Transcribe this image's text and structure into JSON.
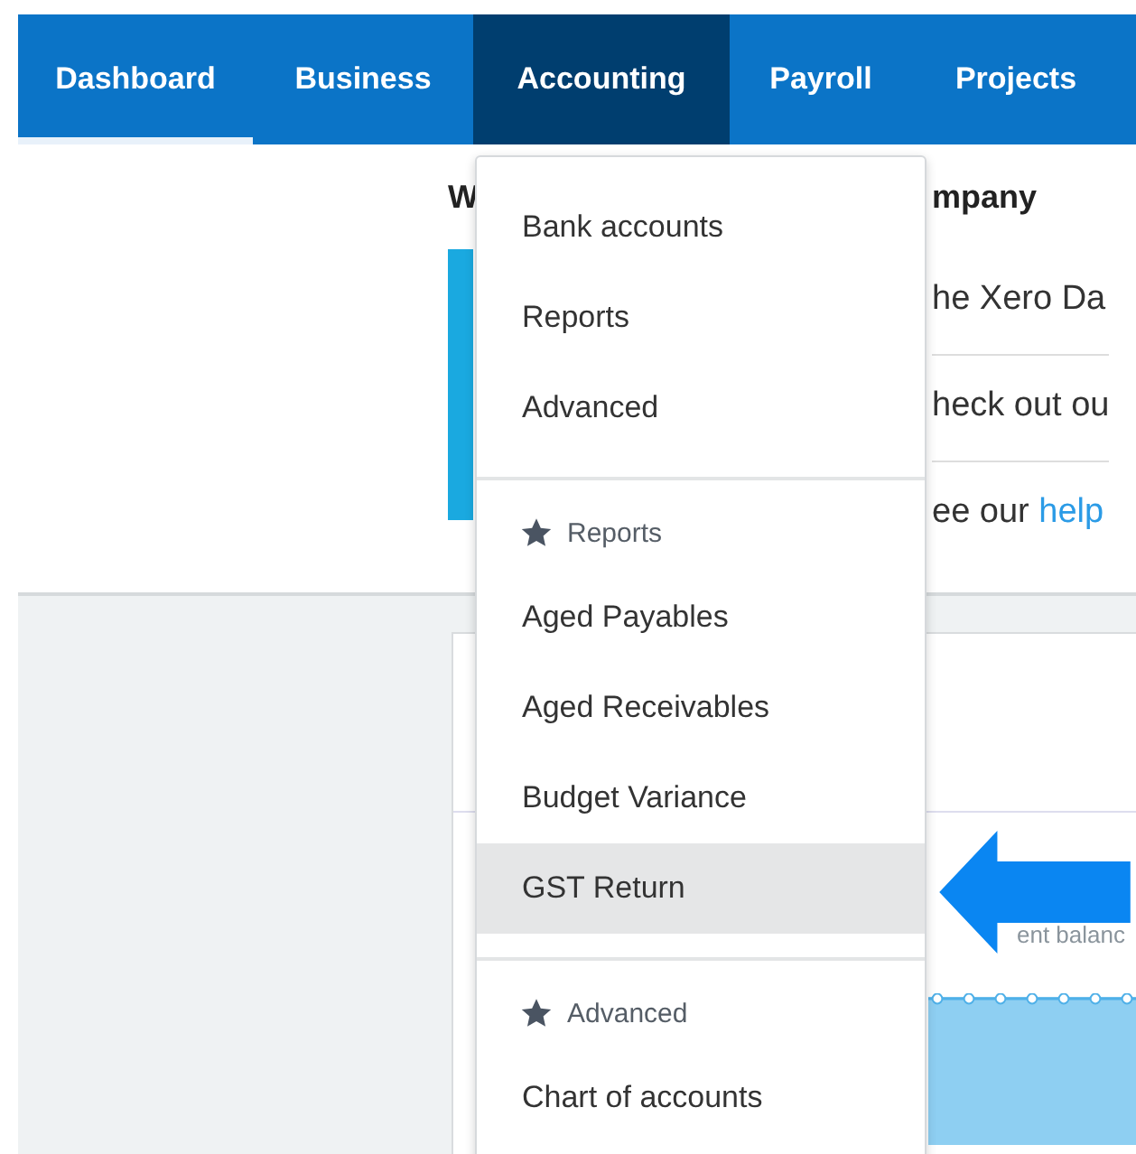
{
  "nav": {
    "tabs": [
      {
        "label": "Dashboard",
        "selected": false,
        "underlined": true
      },
      {
        "label": "Business",
        "selected": false,
        "underlined": false
      },
      {
        "label": "Accounting",
        "selected": true,
        "underlined": false
      },
      {
        "label": "Payroll",
        "selected": false,
        "underlined": false
      },
      {
        "label": "Projects",
        "selected": false,
        "underlined": false
      }
    ]
  },
  "page": {
    "heading_start": "W",
    "heading_end": "mpany",
    "rows": [
      {
        "text": "he Xero Da"
      },
      {
        "text": "heck out ou"
      },
      {
        "text": "ee our ",
        "link": "help"
      }
    ]
  },
  "card": {
    "caption": "ent balanc"
  },
  "menu": {
    "items": [
      {
        "kind": "item",
        "label": "Bank accounts",
        "selected": false
      },
      {
        "kind": "item",
        "label": "Reports",
        "selected": false
      },
      {
        "kind": "item",
        "label": "Advanced",
        "selected": false
      },
      {
        "kind": "divider"
      },
      {
        "kind": "header",
        "label": "Reports"
      },
      {
        "kind": "item",
        "label": "Aged Payables",
        "selected": false
      },
      {
        "kind": "item",
        "label": "Aged Receivables",
        "selected": false
      },
      {
        "kind": "item",
        "label": "Budget Variance",
        "selected": false
      },
      {
        "kind": "item",
        "label": "GST Return",
        "selected": true
      },
      {
        "kind": "divider"
      },
      {
        "kind": "header",
        "label": "Advanced"
      },
      {
        "kind": "item",
        "label": "Chart of accounts",
        "selected": false
      }
    ]
  }
}
